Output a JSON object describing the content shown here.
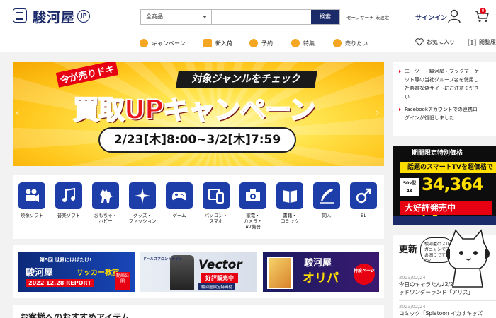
{
  "header": {
    "logo_text": "駿河屋",
    "logo_suffix": "JP",
    "search": {
      "category": "全商品",
      "placeholder": "",
      "button": "検索"
    },
    "safe_search": "セーフサーチ 未設定",
    "signin": "サインイン",
    "cart_count": "0"
  },
  "nav": {
    "items": [
      {
        "label": "キャンペーン",
        "icon": "megaphone-icon"
      },
      {
        "label": "新入荷",
        "icon": "new-icon"
      },
      {
        "label": "予約",
        "icon": "calendar-icon"
      },
      {
        "label": "特集",
        "icon": "star-badge-icon"
      },
      {
        "label": "売りたい",
        "icon": "buy-icon"
      }
    ],
    "favorites": "お気に入り",
    "viewed": "閲覧履"
  },
  "hero": {
    "tag": "今が売りドキ",
    "sub": "対象ジャンルをチェック",
    "title": "買取UPキャンペーン",
    "date": "2/23[木]8:00~3/2[木]7:59",
    "prev": "‹",
    "next": "›"
  },
  "notices": [
    "エーツー・駿河屋・ブックマーケ",
    "ット等の当社グループ名を使用し",
    "た悪質な偽サイトにご注意くださ",
    "い",
    "Facebookアカウントでの連携ロ",
    "グインが復旧しました"
  ],
  "tv_banner": {
    "head": "期間限定特別価格",
    "sub": "話題のスマートTVを超価格で",
    "size": "50v型",
    "res": "4K",
    "price": "34,364円",
    "sale": "大好評発売中"
  },
  "categories": [
    {
      "label": "映像ソフト",
      "icon": "movie-camera-icon"
    },
    {
      "label": "音楽ソフト",
      "icon": "music-note-icon"
    },
    {
      "label": "おもちゃ・\nホビー",
      "icon": "monster-icon"
    },
    {
      "label": "グッズ・\nファッション",
      "icon": "sparkle-icon"
    },
    {
      "label": "ゲーム",
      "icon": "gamepad-icon"
    },
    {
      "label": "パソコン・\nスマホ",
      "icon": "devices-icon"
    },
    {
      "label": "家電・\nカメラ・\nAV機器",
      "icon": "camera-icon"
    },
    {
      "label": "書籍・\nコミック",
      "icon": "book-icon"
    },
    {
      "label": "同人",
      "icon": "pen-icon"
    },
    {
      "label": "BL",
      "icon": "male-symbol-icon"
    }
  ],
  "promos": {
    "p1": {
      "top": "第5回 世界にはばたけ!",
      "logo": "駿河屋",
      "tag": "サッカー教室",
      "foot": "2022 12.28 REPORT",
      "ribbon": "動画公開"
    },
    "p2": {
      "logo": "ドールズフロントライン",
      "title": "Vector",
      "sale": "好評販売中",
      "foot": "駿河屋限定特典付"
    },
    "p3": {
      "logo": "駿河屋",
      "title": "オリパ",
      "badge": "特設ページ"
    }
  },
  "news": {
    "head": "更新",
    "bubble": "駿河屋のスルガニャンです お困りですか？",
    "items": [
      {
        "date": "2023/02/24",
        "text": "今日のキャラたん♪2/24「ア"
      },
      {
        "date": "",
        "text": "ッドワンダーランド「アリス」"
      },
      {
        "date": "2023/02/24",
        "text": "コミック「Splatoon イカすキッズ"
      }
    ]
  },
  "reco": {
    "title": "お客様へのおすすめアイテム"
  }
}
